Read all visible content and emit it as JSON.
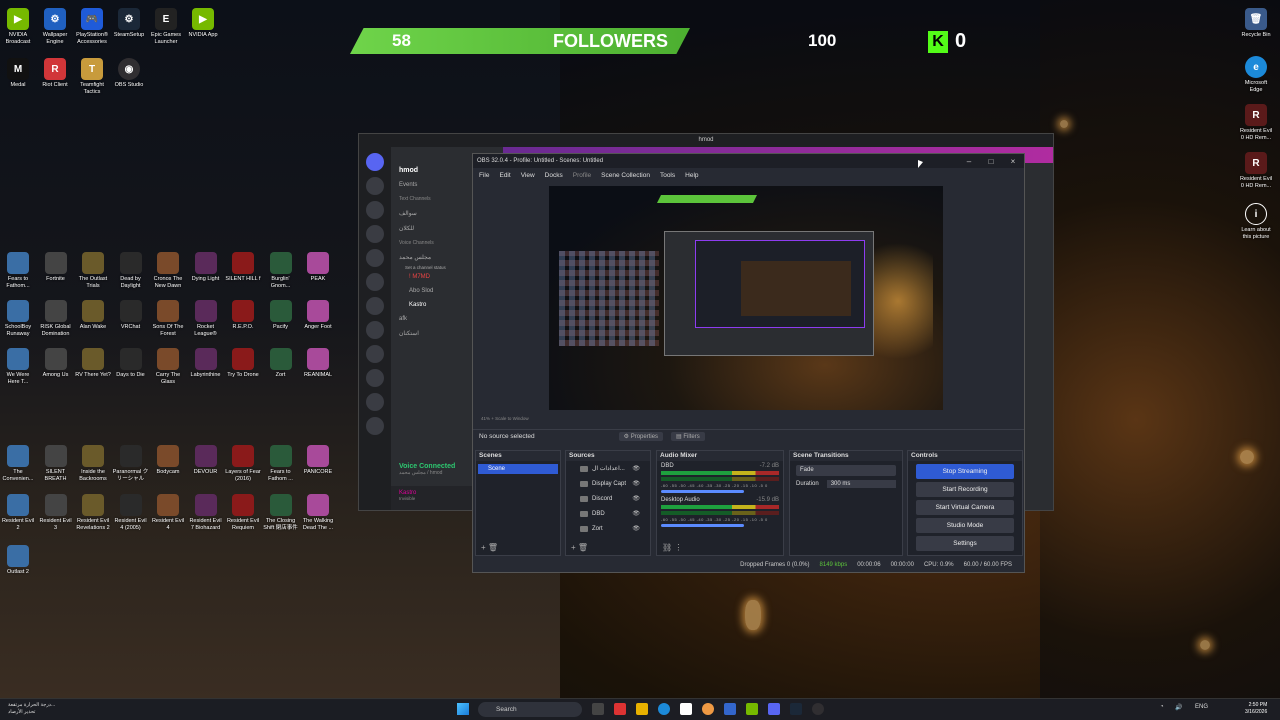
{
  "desktop_icons_left": [
    {
      "label": "NVIDIA Broadcast",
      "icon": "nvidia-icon",
      "color": "#76b900"
    },
    {
      "label": "Wallpaper Engine",
      "icon": "wallpaper-engine-icon",
      "color": "#2060c0"
    },
    {
      "label": "PlayStation® Accessories",
      "icon": "playstation-icon",
      "color": "#1f5bd9"
    },
    {
      "label": "SteamSetup",
      "icon": "steam-icon",
      "color": "#1b2838"
    },
    {
      "label": "Epic Games Launcher",
      "icon": "epic-games-icon",
      "color": "#222"
    },
    {
      "label": "NVIDIA App",
      "icon": "nvidia-app-icon",
      "color": "#76b900"
    },
    {
      "label": "Medal",
      "icon": "medal-icon",
      "color": "#111"
    },
    {
      "label": "Riot Client",
      "icon": "riot-icon",
      "color": "#d13639"
    },
    {
      "label": "Teamfight Tactics",
      "icon": "tft-icon",
      "color": "#c89b3c"
    },
    {
      "label": "OBS Studio",
      "icon": "obs-icon",
      "color": "#302e31"
    }
  ],
  "desktop_games": [
    "Fears to Fathom...",
    "Fortnite",
    "The Outlast Trials",
    "Dead by Daylight",
    "Cronos The New Dawn",
    "Dying Light",
    "SILENT HILL f",
    "Burglin' Gnom...",
    "PEAK",
    "SchoolBoy Runaway",
    "RISK Global Domination",
    "Alan Wake",
    "VRChat",
    "Sons Of The Forest",
    "Rocket League®",
    "R.E.P.O.",
    "Pacify",
    "Anger Foot",
    "We Were Here T...",
    "Among Us",
    "RV There Yet?",
    "Days to Die",
    "Carry The Glass",
    "Labyrinthine",
    "Try To Drone",
    "Zort",
    "REANIMAL",
    "The Convenien...",
    "SILENT BREATH",
    "Inside the Backrooms",
    "Paranormal クリーシャル",
    "Bodycam",
    "DEVOUR",
    "Layers of Fear (2016)",
    "Fears to Fathom ...",
    "PANICORE",
    "Resident Evil 2",
    "Resident Evil 3",
    "Resident Evil Revelations 2",
    "Resident Evil 4 (2005)",
    "Resident Evil 4",
    "Resident Evil 7 Biohazard",
    "Resident Evil Requiem",
    "The Closing Shift 閉店事件",
    "The Walking Dead The ...",
    "Outlast 2"
  ],
  "right_icons": [
    "Recycle Bin",
    "Microsoft Edge",
    "Resident Evil 0 HD Rem...",
    "Resident Evil 0 HD Rem...",
    "Learn about this picture"
  ],
  "follower_goal": {
    "current": "58",
    "label": "FOLLOWERS",
    "goal": "100",
    "kick_count": "0",
    "kick_letter": "K"
  },
  "discord": {
    "title": "hmod",
    "server_name": "hmod",
    "events": "Events",
    "text_channels": "Text Channels",
    "channel1": "سوالف",
    "channel2": "للكلان",
    "voice_channels": "Voice Channels",
    "voice1": "مجلس محمد",
    "voice1_sub": "Set a channel status",
    "member1": "! M7MD",
    "member2": "Abo Slod",
    "member3": "Kastro",
    "voice2": "afk",
    "voice3": "استكنان",
    "voice_connected": "Voice Connected",
    "voice_connected_sub": "مجلس محمد / hmod",
    "user_name": "Kastro",
    "user_status": "Invisible"
  },
  "obs": {
    "title": "OBS 32.0.4 - Profile: Untitled - Scenes: Untitled",
    "menu": [
      "File",
      "Edit",
      "View",
      "Docks",
      "Profile",
      "Scene Collection",
      "Tools",
      "Help"
    ],
    "preview_status": "41%  +  Scale to Window",
    "no_source": "No source selected",
    "properties": "Properties",
    "filters": "Filters",
    "docks": {
      "scenes": "Scenes",
      "sources": "Sources",
      "audio_mixer": "Audio Mixer",
      "scene_transitions": "Scene Transitions",
      "controls": "Controls"
    },
    "scene_items": [
      "Scene"
    ],
    "sources": [
      "اعدادات ال...",
      "Display Capt",
      "Discord",
      "DBD",
      "Zort"
    ],
    "mixer": [
      {
        "name": "DBD",
        "db": "-7.2 dB"
      },
      {
        "name": "Desktop Audio",
        "db": "-15.9 dB"
      }
    ],
    "meter_scale": "-60 -55 -50 -45 -40 -35 -30 -25 -20 -15 -10 -5 0",
    "transition": "Fade",
    "duration_label": "Duration",
    "duration_value": "300 ms",
    "controls": [
      "Stop Streaming",
      "Start Recording",
      "Start Virtual Camera",
      "Studio Mode",
      "Settings"
    ],
    "status": {
      "dropped": "Dropped Frames 0 (0.0%)",
      "bitrate": "8149 kbps",
      "stream_time": "00:00:06",
      "rec_time": "00:00:00",
      "cpu": "CPU: 0.9%",
      "fps": "60.00 / 60.00 FPS"
    }
  },
  "taskbar": {
    "weather_line1": "درجة الحرارة مرتفعة...",
    "weather_line2": "تحذير الأرصاد",
    "search": "Search",
    "lang": "ENG",
    "time": "2:50 PM",
    "date": "3/16/2026"
  },
  "colors": {
    "accent": "#2f5bd4",
    "follower_green": "#5cc43b",
    "kick_green": "#53fc18",
    "discord_voice": "#2dc770"
  }
}
